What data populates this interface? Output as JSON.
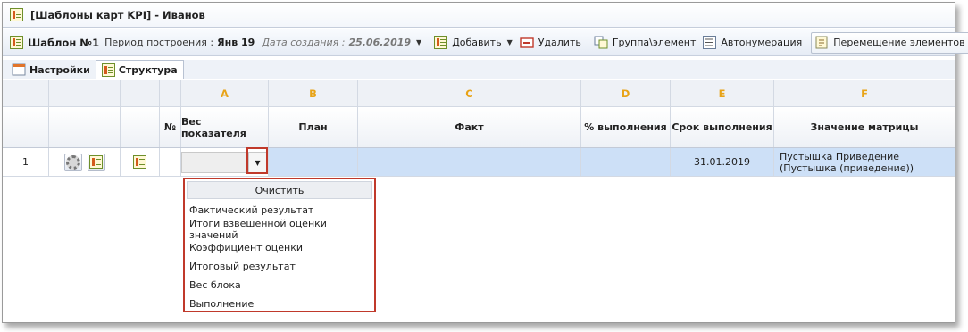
{
  "window": {
    "title": "[Шаблоны карт KPI] - Иванов"
  },
  "toolbar": {
    "template_name": "Шаблон №1",
    "period_label": "Период построения :",
    "period_value": "Янв 19",
    "created_label": "Дата создания :",
    "created_value": "25.06.2019",
    "add_label": "Добавить",
    "delete_label": "Удалить",
    "group_label": "Группа\\элемент",
    "autonumber_label": "Автонумерация",
    "move_label": "Перемещение элементов"
  },
  "tabs": [
    {
      "label": "Настройки",
      "active": false
    },
    {
      "label": "Структура",
      "active": true
    }
  ],
  "grid": {
    "letters": [
      "A",
      "B",
      "C",
      "D",
      "E",
      "F"
    ],
    "headers": {
      "num": "№",
      "weight": "Вес показателя",
      "plan": "План",
      "fact": "Факт",
      "percent": "% выполнения",
      "deadline": "Срок выполнения",
      "matrix": "Значение матрицы"
    },
    "rows": [
      {
        "index": "1",
        "weight": "",
        "plan": "",
        "fact": "",
        "percent": "",
        "deadline": "31.01.2019",
        "matrix": "Пустышка Приведение (Пустышка (приведение))"
      }
    ]
  },
  "dropdown": {
    "clear_label": "Очистить",
    "options": [
      "Фактический результат",
      "Итоги взвешенной оценки значений",
      "Коэффициент оценки",
      "Итоговый результат",
      "Вес блока",
      "Выполнение"
    ]
  },
  "colors": {
    "letter_header": "#e8a317",
    "highlight_row": "#cde0f7",
    "annotation_red": "#c0392b"
  }
}
